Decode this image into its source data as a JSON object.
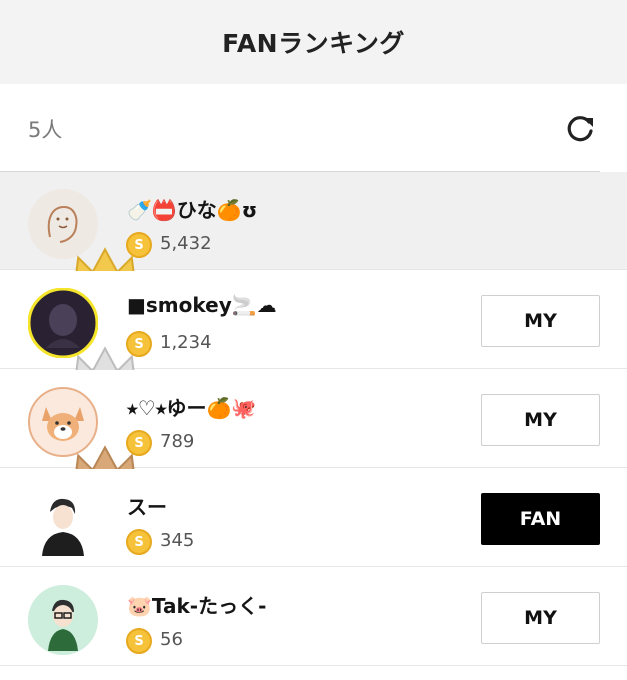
{
  "header": {
    "title": "FANランキング"
  },
  "count": {
    "label": "5人"
  },
  "fans": [
    {
      "rank": "1",
      "name": "🍼📛ひな🍊ʊ",
      "score": "5,432",
      "button": "",
      "coin": "S",
      "highlight": true
    },
    {
      "rank": "2",
      "name": "■smokey🚬☁",
      "score": "1,234",
      "button": "MY",
      "coin": "S",
      "highlight": false
    },
    {
      "rank": "3",
      "name": "⭑♡⭑ゆー🍊🐙",
      "score": "789",
      "button": "MY",
      "coin": "S",
      "highlight": false
    },
    {
      "rank": "",
      "name": "スー",
      "score": "345",
      "button": "FAN",
      "coin": "S",
      "highlight": false
    },
    {
      "rank": "",
      "name": "🐷Tak-たっく-",
      "score": "56",
      "button": "MY",
      "coin": "S",
      "highlight": false
    }
  ],
  "colors": {
    "coin": "#f5c23a",
    "crown": "#f2c94c",
    "silver": "#e0e0e0",
    "bronze": "#d8a878",
    "highlight_row": "#f0f0f0"
  },
  "icons": {
    "refresh": "refresh-icon",
    "coin": "coin-icon",
    "crown": "crown-icon"
  }
}
